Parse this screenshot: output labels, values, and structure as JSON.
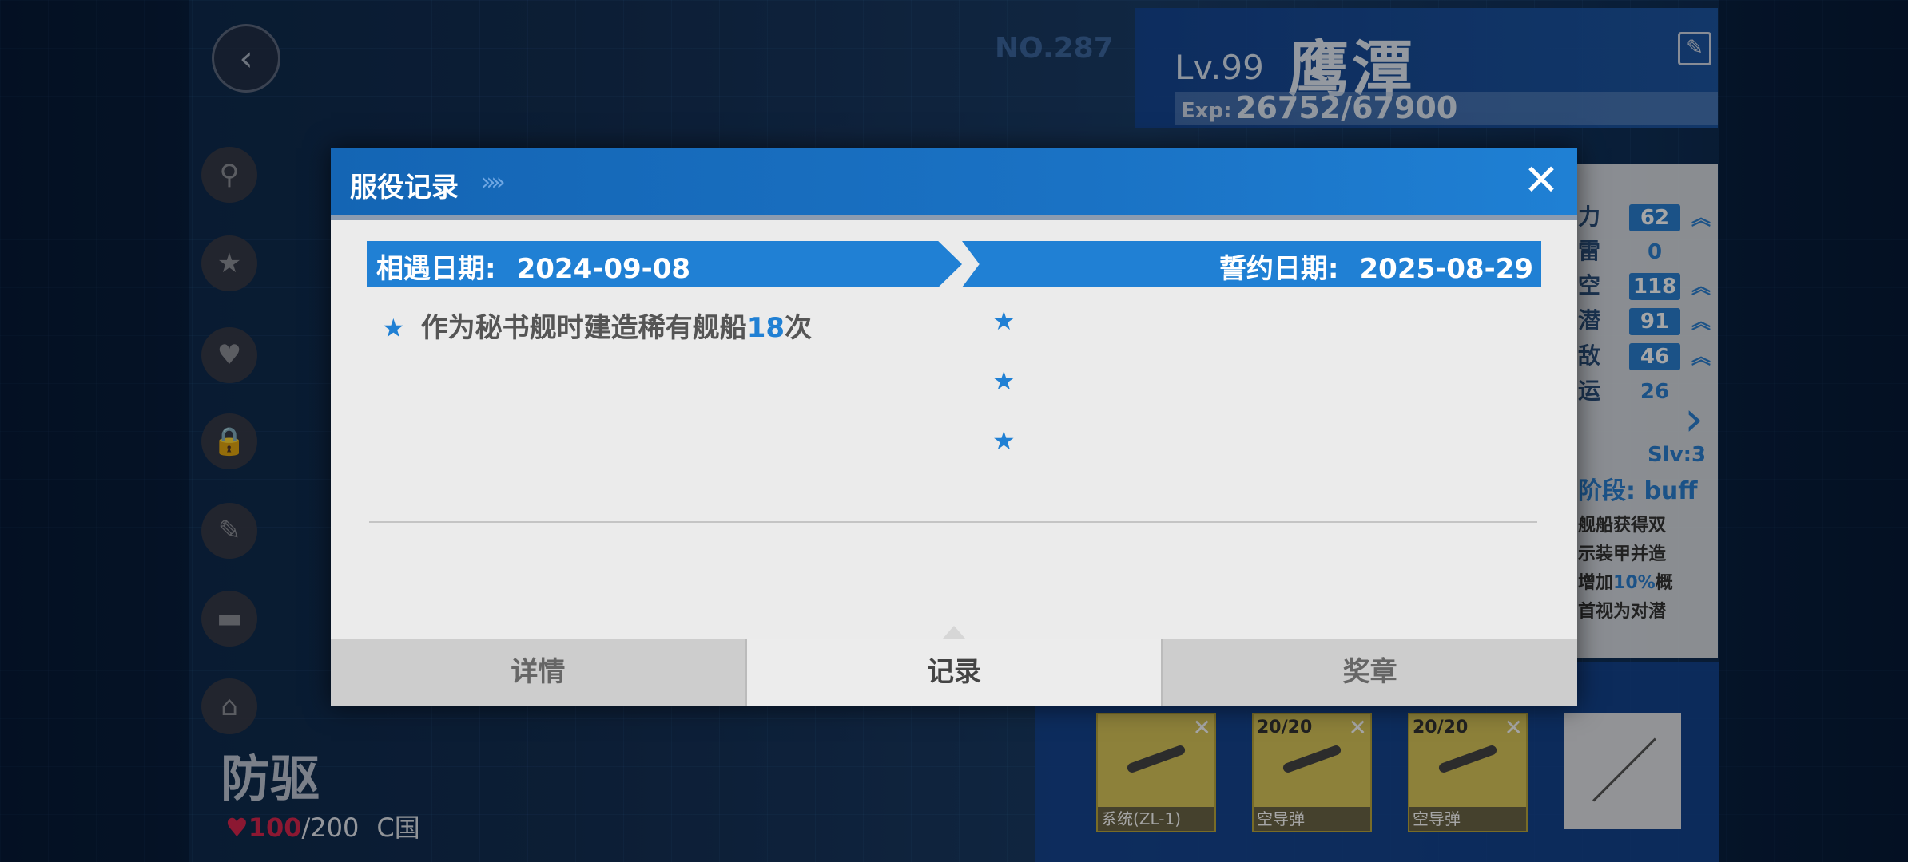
{
  "background": {
    "no_label": "NO.287",
    "ship_level": "Lv.99",
    "ship_name": "鹰潭",
    "exp_label": "Exp:",
    "exp_value": "26752/67900",
    "stats": [
      {
        "label": "力",
        "value": "62",
        "boosted": true
      },
      {
        "label": "雷",
        "value": "0",
        "boosted": false
      },
      {
        "label": "空",
        "value": "118",
        "boosted": true
      },
      {
        "label": "潜",
        "value": "91",
        "boosted": true
      },
      {
        "label": "敌",
        "value": "46",
        "boosted": true
      },
      {
        "label": "运",
        "value": "26",
        "boosted": false
      }
    ],
    "skill_level": "Slv:3",
    "phase_label": "阶段:",
    "phase_value": "buff",
    "skill_lines": [
      "舰船获得双",
      "示装甲并造",
      "增加",
      "10%",
      "概",
      "首视为对潜"
    ],
    "ship_type": "防驱",
    "affinity_current": "100",
    "affinity_max": "/200",
    "nation": "C国",
    "equipment": [
      {
        "count": "",
        "caption": "系统(ZL-1)"
      },
      {
        "count": "20/20",
        "caption": "空导弹"
      },
      {
        "count": "20/20",
        "caption": "空导弹"
      }
    ]
  },
  "modal": {
    "title": "服役记录",
    "meet_label": "相遇日期:",
    "meet_date": "2024-09-08",
    "oath_label": "誓约日期:",
    "oath_date": "2025-08-29",
    "records": [
      {
        "text_before": "作为秘书舰时建造稀有舰船",
        "number": "18",
        "text_after": "次"
      }
    ],
    "tabs": [
      "详情",
      "记录",
      "奖章"
    ],
    "active_tab": "记录"
  },
  "colors": {
    "accent": "#2080d4",
    "header": "#1465b4",
    "affinity": "#d8264e"
  }
}
